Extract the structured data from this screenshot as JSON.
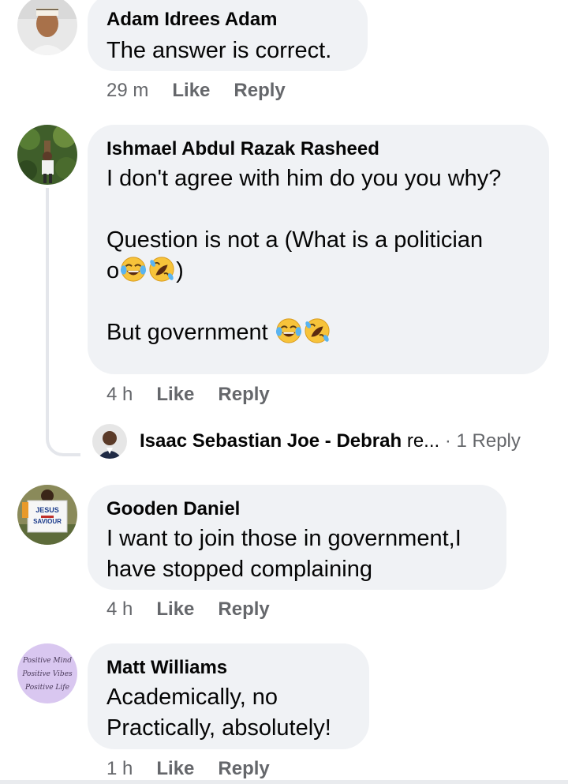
{
  "comments": [
    {
      "author": "Adam Idrees Adam",
      "text": "The answer is correct.",
      "time": "29 m",
      "like_label": "Like",
      "reply_label": "Reply"
    },
    {
      "author": "Ishmael Abdul Razak Rasheed",
      "line1": "I don't agree with him do you you why?",
      "line2": "Question is not a (What is a politician",
      "line3_prefix": "o",
      "line3_suffix": ")",
      "line4": "But government ",
      "time": "4 h",
      "like_label": "Like",
      "reply_label": "Reply",
      "reply_preview": {
        "author": "Isaac Sebastian Joe - Debrah",
        "snippet": " re...",
        "separator": " · ",
        "count": "1 Reply"
      }
    },
    {
      "author": "Gooden Daniel",
      "text": "I want to join those in government,I\nhave stopped complaining",
      "avatar_sign_line1": "JESUS",
      "avatar_sign_line2": "SAVIOUR",
      "time": "4 h",
      "like_label": "Like",
      "reply_label": "Reply"
    },
    {
      "author": "Matt Williams",
      "text": "Academically, no\nPractically, absolutely!",
      "avatar_lines": [
        "Positive Mind",
        "Positive Vibes",
        "Positive Life"
      ],
      "time": "1 h",
      "like_label": "Like",
      "reply_label": "Reply"
    }
  ],
  "icons": {
    "emoji_joy": "face-with-tears-of-joy-icon",
    "emoji_rofl": "rolling-on-floor-laughing-icon"
  },
  "colors": {
    "bubble": "#f0f2f5",
    "meta": "#65676b",
    "text": "#050505",
    "emoji_yellow": "#f7c33a"
  }
}
